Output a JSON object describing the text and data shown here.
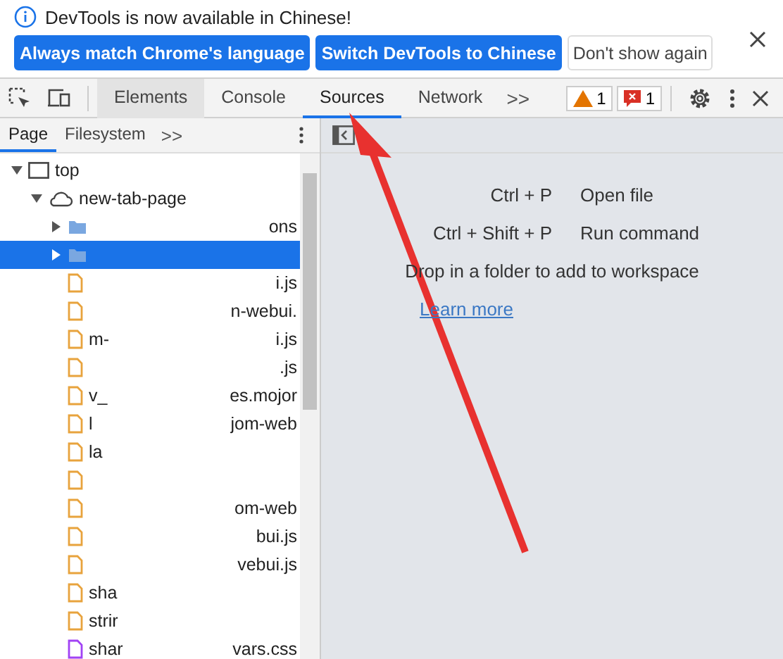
{
  "infobar": {
    "message": "DevTools is now available in Chinese!",
    "buttons": [
      {
        "label": "Always match Chrome's language",
        "kind": "primary"
      },
      {
        "label": "Switch DevTools to Chinese",
        "kind": "primary"
      },
      {
        "label": "Don't show again",
        "kind": "secondary"
      }
    ]
  },
  "tabs": [
    {
      "label": "Elements",
      "selected": false
    },
    {
      "label": "Console",
      "selected": false
    },
    {
      "label": "Sources",
      "selected": true
    },
    {
      "label": "Network",
      "selected": false
    }
  ],
  "more_tabs": ">>",
  "warnings": "1",
  "errors": "1",
  "subtabs": [
    {
      "label": "Page",
      "selected": true
    },
    {
      "label": "Filesystem",
      "selected": false
    }
  ],
  "more_subtabs": ">>",
  "tree": [
    {
      "label": "top",
      "kind": "frame",
      "expanded": true,
      "children": [
        {
          "label": "new-tab-page",
          "kind": "origin",
          "expanded": true,
          "children": [
            {
              "kind": "folder",
              "expanded": false,
              "right": "ons",
              "selected": false
            },
            {
              "kind": "folder",
              "expanded": false,
              "selected": true
            },
            {
              "kind": "js",
              "right": "i.js",
              "selected": false
            },
            {
              "kind": "js",
              "right": "n-webui.",
              "selected": false
            },
            {
              "kind": "js",
              "left": "m-",
              "right": "i.js",
              "selected": false
            },
            {
              "kind": "js",
              "right": ".js",
              "selected": false
            },
            {
              "kind": "js",
              "left": "v_",
              "right": "es.mojor",
              "selected": false
            },
            {
              "kind": "js",
              "left": "l",
              "right": "jom-web",
              "selected": false
            },
            {
              "kind": "js",
              "left": "la",
              "selected": false
            },
            {
              "kind": "js",
              "selected": false
            },
            {
              "kind": "js",
              "right": "om-web",
              "selected": false
            },
            {
              "kind": "js",
              "right": "bui.js",
              "selected": false
            },
            {
              "kind": "js",
              "right": "vebui.js",
              "selected": false
            },
            {
              "kind": "js",
              "left": "sha",
              "selected": false
            },
            {
              "kind": "js",
              "left": "strir",
              "selected": false
            },
            {
              "kind": "css",
              "left": "shar",
              "right": "vars.css",
              "selected": false
            }
          ]
        }
      ]
    }
  ],
  "shortcuts": [
    {
      "keys": "Ctrl + P",
      "action": "Open file"
    },
    {
      "keys": "Ctrl + Shift + P",
      "action": "Run command"
    }
  ],
  "drop_hint": "Drop in a folder to add to workspace",
  "learn_more": "Learn more"
}
